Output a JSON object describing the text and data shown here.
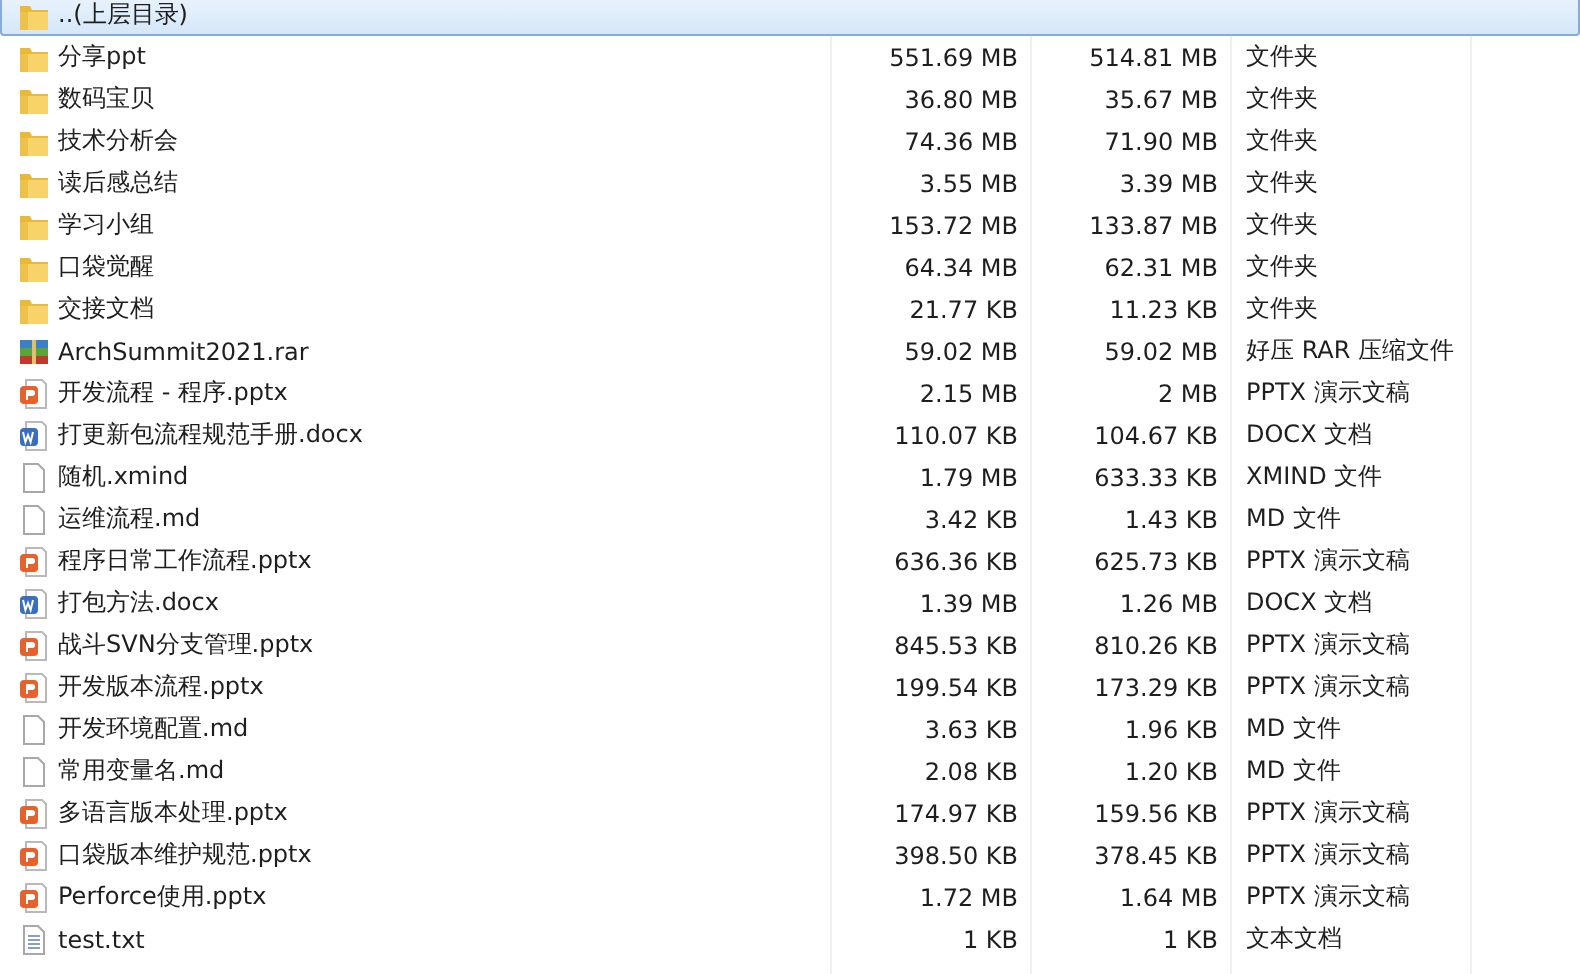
{
  "files": [
    {
      "kind": "folder",
      "name": "..(上层目录)",
      "selected": true
    },
    {
      "kind": "folder",
      "name": "分享ppt",
      "size": "551.69 MB",
      "packed": "514.81 MB",
      "type": "文件夹",
      "selected": false
    },
    {
      "kind": "folder",
      "name": "数码宝贝",
      "size": "36.80 MB",
      "packed": "35.67 MB",
      "type": "文件夹",
      "selected": false
    },
    {
      "kind": "folder",
      "name": "技术分析会",
      "size": "74.36 MB",
      "packed": "71.90 MB",
      "type": "文件夹",
      "selected": false
    },
    {
      "kind": "folder",
      "name": "读后感总结",
      "size": "3.55 MB",
      "packed": "3.39 MB",
      "type": "文件夹",
      "selected": false
    },
    {
      "kind": "folder",
      "name": "学习小组",
      "size": "153.72 MB",
      "packed": "133.87 MB",
      "type": "文件夹",
      "selected": false
    },
    {
      "kind": "folder",
      "name": "口袋觉醒",
      "size": "64.34 MB",
      "packed": "62.31 MB",
      "type": "文件夹",
      "selected": false
    },
    {
      "kind": "folder",
      "name": "交接文档",
      "size": "21.77 KB",
      "packed": "11.23 KB",
      "type": "文件夹",
      "selected": false
    },
    {
      "kind": "archive",
      "name": "ArchSummit2021.rar",
      "size": "59.02 MB",
      "packed": "59.02 MB",
      "type": "好压 RAR 压缩文件",
      "selected": false
    },
    {
      "kind": "slides",
      "name": "开发流程 - 程序.pptx",
      "size": "2.15 MB",
      "packed": "2 MB",
      "type": "PPTX 演示文稿",
      "selected": false
    },
    {
      "kind": "doc",
      "name": "打更新包流程规范手册.docx",
      "size": "110.07 KB",
      "packed": "104.67 KB",
      "type": "DOCX 文档",
      "selected": false
    },
    {
      "kind": "blank",
      "name": "随机.xmind",
      "size": "1.79 MB",
      "packed": "633.33 KB",
      "type": "XMIND 文件",
      "selected": false
    },
    {
      "kind": "blank",
      "name": "运维流程.md",
      "size": "3.42 KB",
      "packed": "1.43 KB",
      "type": "MD 文件",
      "selected": false
    },
    {
      "kind": "slides",
      "name": "程序日常工作流程.pptx",
      "size": "636.36 KB",
      "packed": "625.73 KB",
      "type": "PPTX 演示文稿",
      "selected": false
    },
    {
      "kind": "doc",
      "name": "打包方法.docx",
      "size": "1.39 MB",
      "packed": "1.26 MB",
      "type": "DOCX 文档",
      "selected": false
    },
    {
      "kind": "slides",
      "name": "战斗SVN分支管理.pptx",
      "size": "845.53 KB",
      "packed": "810.26 KB",
      "type": "PPTX 演示文稿",
      "selected": false
    },
    {
      "kind": "slides",
      "name": "开发版本流程.pptx",
      "size": "199.54 KB",
      "packed": "173.29 KB",
      "type": "PPTX 演示文稿",
      "selected": false
    },
    {
      "kind": "blank",
      "name": "开发环境配置.md",
      "size": "3.63 KB",
      "packed": "1.96 KB",
      "type": "MD 文件",
      "selected": false
    },
    {
      "kind": "blank",
      "name": "常用变量名.md",
      "size": "2.08 KB",
      "packed": "1.20 KB",
      "type": "MD 文件",
      "selected": false
    },
    {
      "kind": "slides",
      "name": "多语言版本处理.pptx",
      "size": "174.97 KB",
      "packed": "159.56 KB",
      "type": "PPTX 演示文稿",
      "selected": false
    },
    {
      "kind": "slides",
      "name": "口袋版本维护规范.pptx",
      "size": "398.50 KB",
      "packed": "378.45 KB",
      "type": "PPTX 演示文稿",
      "selected": false
    },
    {
      "kind": "slides",
      "name": "Perforce使用.pptx",
      "size": "1.72 MB",
      "packed": "1.64 MB",
      "type": "PPTX 演示文稿",
      "selected": false
    },
    {
      "kind": "text",
      "name": "test.txt",
      "size": "1 KB",
      "packed": "1 KB",
      "type": "文本文档",
      "selected": false
    }
  ]
}
